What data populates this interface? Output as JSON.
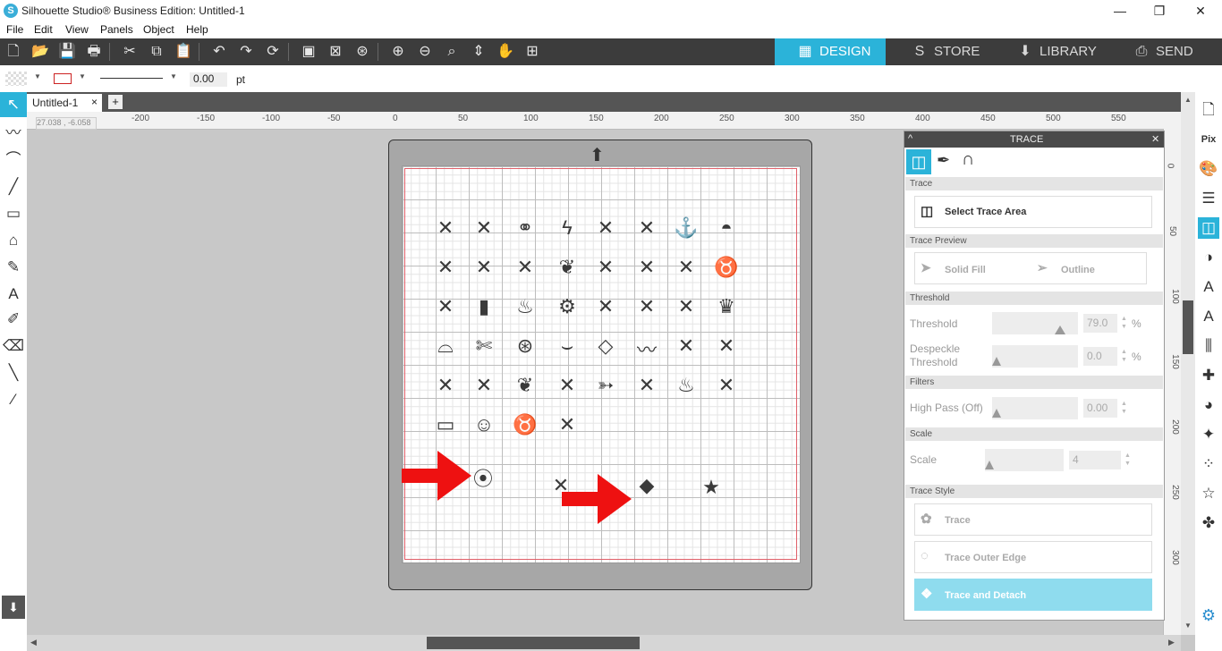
{
  "window": {
    "title": "Silhouette Studio® Business Edition: Untitled-1",
    "logo_letter": "S",
    "minimize": "—",
    "restore": "❐",
    "close": "✕"
  },
  "menu": [
    "File",
    "Edit",
    "View",
    "Panels",
    "Object",
    "Help"
  ],
  "toolbar": {
    "icons": [
      "new-icon",
      "open-icon",
      "save-icon",
      "print-icon",
      "cut-icon",
      "copy-icon",
      "paste-icon",
      "undo-icon",
      "redo-icon",
      "redraw-icon",
      "group-icon",
      "ungroup-icon",
      "compound-icon",
      "zoom-in-icon",
      "zoom-out-icon",
      "zoom-select-icon",
      "fit-page-icon",
      "pan-icon",
      "add-page-icon"
    ],
    "glyphs": [
      "🗋",
      "📂",
      "💾",
      "🖶",
      "✂",
      "⧉",
      "📋",
      "↶",
      "↷",
      "⟳",
      "▣",
      "⊠",
      "⊛",
      "⊕",
      "⊖",
      "⌕",
      "⇕",
      "✋",
      "⊞"
    ],
    "tabs": [
      {
        "label": "DESIGN",
        "glyph": "▦",
        "active": true
      },
      {
        "label": "STORE",
        "glyph": "S",
        "active": false
      },
      {
        "label": "LIBRARY",
        "glyph": "⬇",
        "active": false
      },
      {
        "label": "SEND",
        "glyph": "⎙",
        "active": false
      }
    ]
  },
  "propbar": {
    "line_width": "0.00",
    "unit": "pt",
    "dropdown_arrow": "▼"
  },
  "doc_tab": {
    "label": "Untitled-1",
    "close": "×",
    "add": "+"
  },
  "coord_readout": "27.038 , -6.058",
  "ruler": {
    "h_labels": [
      "-200",
      "-150",
      "-100",
      "-50",
      "0",
      "50",
      "100",
      "150",
      "200",
      "250",
      "300",
      "350",
      "400",
      "450",
      "500",
      "550"
    ],
    "v_labels": [
      "0",
      "50",
      "100",
      "150",
      "200",
      "250",
      "300"
    ]
  },
  "trace_panel": {
    "title": "TRACE",
    "collapse": "^",
    "close": "✕",
    "sections": {
      "trace": "Trace",
      "preview": "Trace Preview",
      "threshold": "Threshold",
      "filters": "Filters",
      "scale": "Scale",
      "style": "Trace Style"
    },
    "select_trace_area": "Select Trace Area",
    "solid_fill": "Solid Fill",
    "outline": "Outline",
    "threshold_label": "Threshold",
    "threshold_value": "79.0",
    "threshold_unit": "%",
    "despeckle_label": "Despeckle Threshold",
    "despeckle_value": "0.0",
    "despeckle_unit": "%",
    "highpass_label": "High Pass (Off)",
    "highpass_value": "0.00",
    "scale_label": "Scale",
    "scale_value": "4",
    "btn_trace": "Trace",
    "btn_outer": "Trace Outer Edge",
    "btn_detach": "Trace and Detach"
  },
  "colors": {
    "accent": "#2bb3d9",
    "detach_bg": "#8fdcee",
    "arrow_red": "#ee1111",
    "toolbar_bg": "#3c3c3c"
  },
  "canvas_glyphs": [
    "✕",
    "✕",
    "⚭",
    "ϟ",
    "✕",
    "✕",
    "⚓",
    "◓",
    "✕",
    "✕",
    "✕",
    "❦",
    "✕",
    "✕",
    "✕",
    "♉",
    "✕",
    "▮",
    "♨",
    "⚙",
    "✕",
    "✕",
    "✕",
    "♛",
    "⌓",
    "✄",
    "⊛",
    "⌣",
    "◇",
    "〰",
    "✕",
    "✕",
    "✕",
    "✕",
    "❦",
    "✕",
    "➳",
    "✕",
    "♨",
    "✕",
    "▭",
    "☺",
    "♉",
    "✕",
    "⦿",
    "✕",
    "◆",
    "★"
  ],
  "left_tools": [
    "select-icon",
    "point-edit-icon",
    "curve-icon",
    "line-icon",
    "rectangle-icon",
    "polygon-icon",
    "pencil-icon",
    "text-icon",
    "knife-icon",
    "eraser-icon",
    "brush-icon",
    "eyedropper-icon"
  ],
  "left_tool_glyphs": [
    "↖",
    "〰",
    "⌒",
    "╱",
    "▭",
    "⌂",
    "✎",
    "A",
    "✐",
    "⌫",
    "╲",
    "⁄"
  ],
  "right_tools": [
    "page-setup-icon",
    "pixscan-icon",
    "fill-icon",
    "line-style-icon",
    "trace-icon",
    "transparency-icon",
    "text-style-icon",
    "sketch-icon",
    "align-icon",
    "replicate-icon",
    "modify-icon",
    "offset-icon",
    "rhinestone-icon",
    "star-icon",
    "puzzle-icon"
  ],
  "right_tool_glyphs": [
    "🗋",
    "Pix",
    "🎨",
    "☰",
    "◫",
    "◑",
    "A",
    "A",
    "⫼",
    "✚",
    "◕",
    "✦",
    "⁘",
    "☆",
    "✤"
  ]
}
